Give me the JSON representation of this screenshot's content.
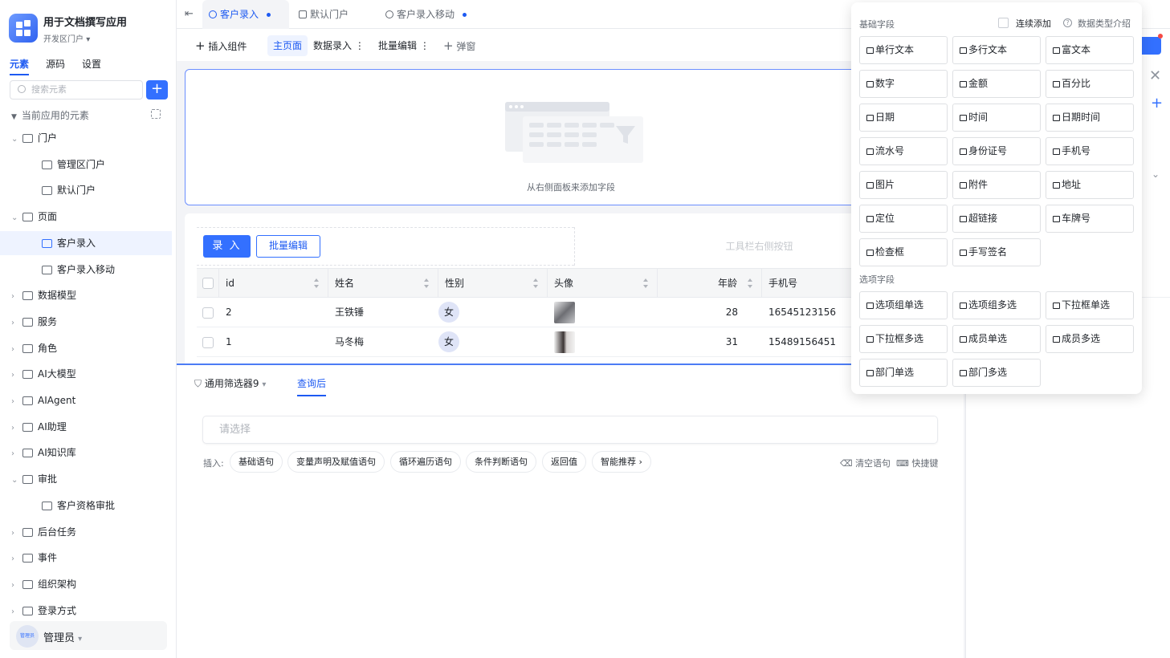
{
  "app": {
    "name": "用于文档撰写应用",
    "portal": "开发区门户"
  },
  "left_tabs": [
    "元素",
    "源码",
    "设置"
  ],
  "search": {
    "placeholder": "搜索元素"
  },
  "tree_header": "当前应用的元素",
  "tree": [
    {
      "label": "门户",
      "icon": "home-icon",
      "level": 0,
      "expanded": true
    },
    {
      "label": "管理区门户",
      "icon": "portal-icon",
      "level": 1
    },
    {
      "label": "默认门户",
      "icon": "portal-icon",
      "level": 1
    },
    {
      "label": "页面",
      "icon": "page-icon",
      "level": 0,
      "expanded": true
    },
    {
      "label": "客户录入",
      "icon": "page-web-icon",
      "level": 1,
      "selected": true
    },
    {
      "label": "客户录入移动",
      "icon": "page-web-icon",
      "level": 1
    },
    {
      "label": "数据模型",
      "icon": "table-icon",
      "level": 0
    },
    {
      "label": "服务",
      "icon": "service-icon",
      "level": 0
    },
    {
      "label": "角色",
      "icon": "role-icon",
      "level": 0
    },
    {
      "label": "AI大模型",
      "icon": "ai-model-icon",
      "level": 0
    },
    {
      "label": "AIAgent",
      "icon": "agent-icon",
      "level": 0
    },
    {
      "label": "AI助理",
      "icon": "ai-assistant-icon",
      "level": 0
    },
    {
      "label": "AI知识库",
      "icon": "knowledge-icon",
      "level": 0
    },
    {
      "label": "审批",
      "icon": "approval-icon",
      "level": 0,
      "expanded": true
    },
    {
      "label": "客户资格审批",
      "icon": "user-icon",
      "level": 1
    },
    {
      "label": "后台任务",
      "icon": "task-icon",
      "level": 0
    },
    {
      "label": "事件",
      "icon": "event-icon",
      "level": 0
    },
    {
      "label": "组织架构",
      "icon": "org-icon",
      "level": 0
    },
    {
      "label": "登录方式",
      "icon": "login-icon",
      "level": 0
    }
  ],
  "user": {
    "name": "管理员",
    "avatar_text": "管理员"
  },
  "tabs": [
    {
      "label": "客户录入",
      "active": true,
      "dot": true
    },
    {
      "label": "默认门户",
      "active": false,
      "dot": false
    },
    {
      "label": "客户录入移动",
      "active": false,
      "dot": true
    }
  ],
  "toolbar": {
    "insert": "插入组件",
    "main": "主页面",
    "data_entry": "数据录入",
    "batch": "批量编辑",
    "popup": "弹窗"
  },
  "empty": {
    "text": "从右侧面板来添加字段"
  },
  "table_card": {
    "primary": "录 入",
    "outline": "批量编辑",
    "slot": "工具栏右侧按钮"
  },
  "table": {
    "columns": [
      "id",
      "姓名",
      "性别",
      "头像",
      "年龄",
      "手机号"
    ],
    "rows": [
      {
        "id": "2",
        "name": "王铁锤",
        "gender": "女",
        "age": "28",
        "phone": "16545123156"
      },
      {
        "id": "1",
        "name": "马冬梅",
        "gender": "女",
        "age": "31",
        "phone": "15489156451"
      }
    ]
  },
  "bottom": {
    "filter_tab": "通用筛选器9",
    "after_tab": "查询后",
    "select_placeholder": "请选择",
    "insert_label": "插入:",
    "chips": [
      "基础语句",
      "变量声明及赋值语句",
      "循环遍历语句",
      "条件判断语句",
      "返回值",
      "智能推荐 ›"
    ],
    "clear": "清空语句",
    "shortcut": "快捷键"
  },
  "popup": {
    "basic_title": "基础字段",
    "continuous": "连续添加",
    "type_intro": "数据类型介绍",
    "basic": [
      "单行文本",
      "多行文本",
      "富文本",
      "数字",
      "金额",
      "百分比",
      "日期",
      "时间",
      "日期时间",
      "流水号",
      "身份证号",
      "手机号",
      "图片",
      "附件",
      "地址",
      "定位",
      "超链接",
      "车牌号",
      "检查框",
      "手写签名"
    ],
    "option_title": "选项字段",
    "options": [
      "选项组单选",
      "选项组多选",
      "下拉框单选",
      "下拉框多选",
      "成员单选",
      "成员多选",
      "部门单选",
      "部门多选"
    ]
  },
  "colors": {
    "primary": "#3370ff",
    "text": "#1f2329",
    "muted": "#646a73"
  }
}
